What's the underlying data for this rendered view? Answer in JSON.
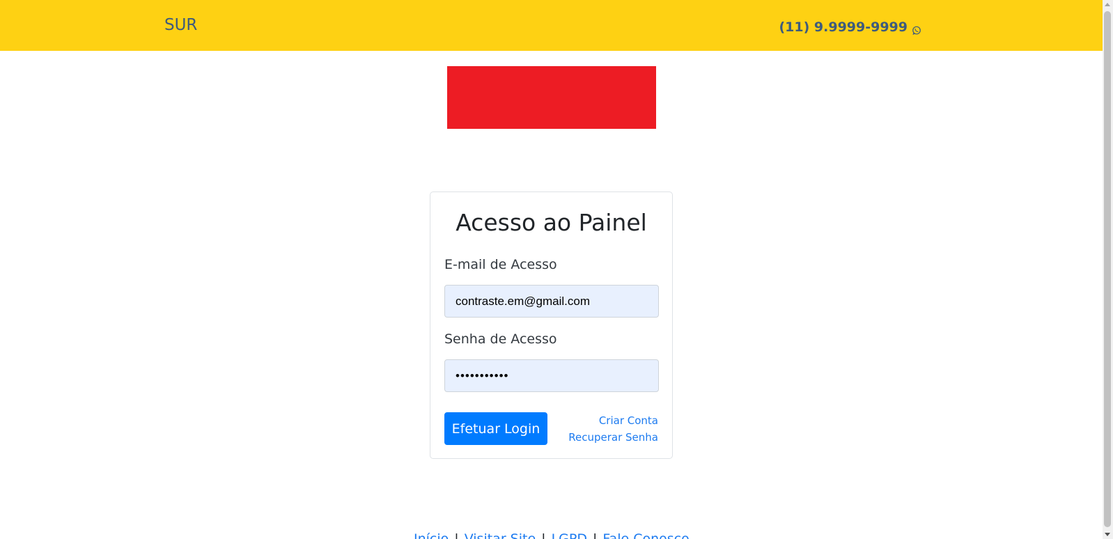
{
  "header": {
    "brand": "SUR",
    "phone": "(11) 9.9999-9999",
    "phone_icon": "whatsapp-icon",
    "background_color": "#fed113",
    "text_color": "#3e5b7c"
  },
  "logo": {
    "color": "#ed1c24"
  },
  "login": {
    "title": "Acesso ao Painel",
    "email_label": "E-mail de Acesso",
    "email_value": "contraste.em@gmail.com",
    "password_label": "Senha de Acesso",
    "password_value": "•••••••••••",
    "submit_label": "Efetuar Login",
    "create_account_link": "Criar Conta",
    "recover_password_link": "Recuperar Senha",
    "accent_color": "#007bff"
  },
  "footer": {
    "links": [
      "Início",
      "Visitar Site",
      "LGPD",
      "Fale Conosco"
    ],
    "separator": "|"
  }
}
